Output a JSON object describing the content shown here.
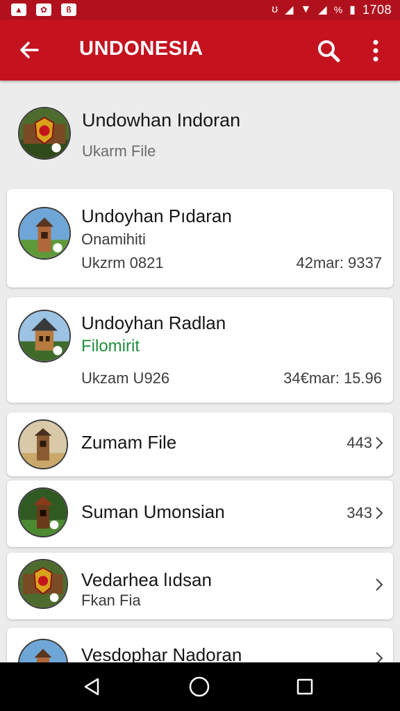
{
  "app_bar": {
    "title": "UNDONESIA"
  },
  "header": {
    "title": "Undowhan Indoran",
    "subtitle": "Ukarm File"
  },
  "items": [
    {
      "title": "Undoyhan Pıdaran",
      "subtitle": "Onamihiti",
      "meta": "Ukzrm 0821",
      "right": "42mar: 9337"
    },
    {
      "title": "Undoyhan Radlan",
      "subtitle": "Filomirit",
      "meta": "Ukzam U926",
      "right": "34€mar: 15.96"
    },
    {
      "title": "Zumam File",
      "count": "443"
    },
    {
      "title": "Suman Umonsian",
      "count": "343"
    },
    {
      "title": "Vedarhea lıdsan",
      "subtitle": "Fkan Fia"
    },
    {
      "title": "Vesdophar Nadoran"
    }
  ],
  "status_bar": {
    "time": "1708",
    "battery": "%"
  },
  "colors": {
    "app_bar": "#c4121f",
    "status_bar": "#b0111d",
    "accent_green": "#1f8e3c"
  }
}
